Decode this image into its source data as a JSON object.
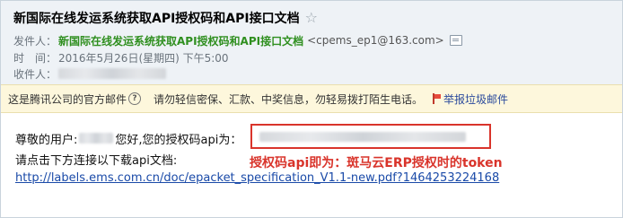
{
  "email": {
    "subject": "新国际在线发运系统获取API授权码和API接口文档",
    "star_icon": "star-icon",
    "sender_label": "发件人：",
    "sender_name": "新国际在线发运系统获取API授权码和API接口文档",
    "sender_address": "<cpems_ep1@163.com>",
    "sender_card_icon": "contact-card-icon",
    "time_label": "时　间：",
    "time_value": "2016年5月26日(星期四) 下午5:00",
    "recipient_label": "收件人："
  },
  "notice": {
    "official_text": "这是腾讯公司的官方邮件",
    "help_icon_text": "?",
    "warning_text": "请勿轻信密保、汇款、中奖信息，勿轻易拨打陌生电话。",
    "report_label": "举报垃圾邮件"
  },
  "body": {
    "greeting_prefix": "尊敬的用户:",
    "greeting_suffix": "您好,您的授权码api为：",
    "instruction": "请点击下方连接以下载api文档:",
    "doc_link": "http://labels.ems.com.cn/doc/epacket_specification_V1.1-new.pdf?1464253224168",
    "annotation": "授权码api即为：斑马云ERP授权时的token"
  },
  "colors": {
    "header_bg": "#eef2f6",
    "sender_green": "#2f8f1f",
    "notice_bg": "#fdf7dc",
    "link_blue": "#1a4aa8",
    "annotation_red": "#d9342b"
  }
}
